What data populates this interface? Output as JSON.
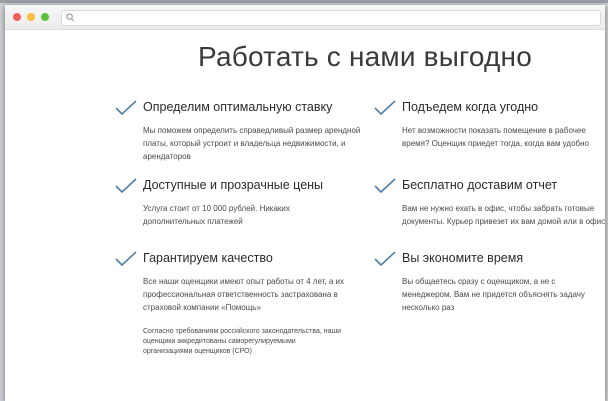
{
  "page": {
    "title": "Работать с нами выгодно"
  },
  "features_left": [
    {
      "title": "Определим оптимальную ставку",
      "desc": "Мы поможем определить справедливый размер арендной платы, который устроит и владельца недвижимости, и арендаторов",
      "icon": "check-icon"
    },
    {
      "title": "Доступные и прозрачные цены",
      "desc": "Услуга стоит от 10 000 рублей. Никаких дополнительных платежей",
      "icon": "check-icon"
    },
    {
      "title": "Гарантируем качество",
      "desc": "Все наши оценщики имеют опыт работы от 4 лет, а их профессиональная ответственность застрахована в страховой компании «Помощь»",
      "note": "Согласно требованиям российского законодательства, наши оценщики аккредитованы саморегулируемыми организациями оценщиков (СРО)",
      "icon": "check-icon"
    }
  ],
  "features_right": [
    {
      "title": "Подъедем когда угодно",
      "desc": "Нет возможности показать помещение в рабочее время? Оценщик приедет тогда, когда вам удобно",
      "icon": "check-icon"
    },
    {
      "title": "Бесплатно доставим отчет",
      "desc": "Вам не нужно ехать в офис, чтобы забрать готовые документы. Курьер привезет их вам домой или в офис",
      "icon": "check-icon"
    },
    {
      "title": "Вы экономите время",
      "desc": "Вы общаетесь сразу с оценщиком, а не с менеджером. Вам не придется объяснять задачу несколько раз",
      "icon": "check-icon"
    }
  ],
  "colors": {
    "check": "#4f7fa8",
    "dot_red": "#f25f58",
    "dot_yellow": "#fbbe3c",
    "dot_green": "#59c23e"
  }
}
